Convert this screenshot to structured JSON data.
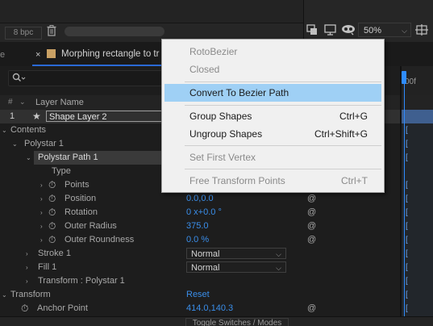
{
  "toolbar": {
    "bit_depth": "8 bpc",
    "trash_icon": "trash-icon",
    "zoom_value": "50%"
  },
  "tab": {
    "close": "×",
    "label": "Morphing rectangle to tr"
  },
  "timeline": {
    "time_label": "00f"
  },
  "columns": {
    "hash": "#",
    "layer_name": "Layer Name"
  },
  "layer": {
    "number": "1",
    "name": "Shape Layer 2"
  },
  "tree": {
    "contents": "Contents",
    "polystar": "Polystar 1",
    "polystar_path": "Polystar Path 1",
    "type": "Type",
    "points": "Points",
    "position": "Position",
    "position_value": "0.0,0.0",
    "rotation": "Rotation",
    "rotation_value": "0 x+0.0 °",
    "outer_radius": "Outer Radius",
    "outer_radius_value": "375.0",
    "outer_roundness": "Outer Roundness",
    "outer_roundness_value": "0.0 %",
    "stroke": "Stroke 1",
    "stroke_mode": "Normal",
    "fill": "Fill 1",
    "fill_mode": "Normal",
    "transform_polystar": "Transform : Polystar 1",
    "transform": "Transform",
    "transform_reset": "Reset",
    "anchor_point": "Anchor Point",
    "anchor_point_value": "414.0,140.3"
  },
  "bottom": {
    "toggle": "Toggle Switches / Modes"
  },
  "context_menu": {
    "items": [
      {
        "label": "RotoBezier",
        "shortcut": "",
        "disabled": true
      },
      {
        "label": "Closed",
        "shortcut": "",
        "disabled": true
      },
      {
        "label": "Convert To Bezier Path",
        "shortcut": "",
        "highlighted": true
      },
      {
        "label": "Group Shapes",
        "shortcut": "Ctrl+G"
      },
      {
        "label": "Ungroup Shapes",
        "shortcut": "Ctrl+Shift+G"
      },
      {
        "label": "Set First Vertex",
        "shortcut": "",
        "disabled": true
      },
      {
        "label": "Free Transform Points",
        "shortcut": "Ctrl+T",
        "disabled": true
      }
    ]
  },
  "colors": {
    "accent": "#2f8cff",
    "menu_highlight": "#9fd0f5",
    "property_value": "#3a8eea"
  }
}
